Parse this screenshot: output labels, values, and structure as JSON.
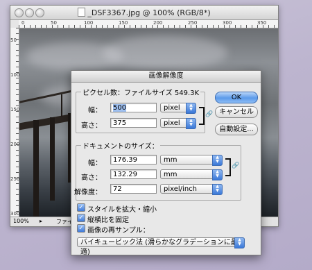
{
  "document": {
    "title": "_DSF3367.jpg @ 100% (RGB/8*)",
    "status": {
      "zoom": "100%",
      "info": "ファイル"
    },
    "ruler_top_labels": [
      "0",
      "50",
      "100",
      "150",
      "200",
      "250",
      "300",
      "350"
    ],
    "ruler_left_labels": [
      "50",
      "100",
      "150",
      "200",
      "250",
      "300"
    ]
  },
  "dialog": {
    "title": "画像解像度",
    "pixel_dimensions": {
      "header": "ピクセル数：ファイルサイズ 549.3K",
      "width_label": "幅：",
      "width_value": "500",
      "width_unit": "pixel",
      "height_label": "高さ：",
      "height_value": "375",
      "height_unit": "pixel"
    },
    "document_size": {
      "header": "ドキュメントのサイズ：",
      "width_label": "幅：",
      "width_value": "176.39",
      "width_unit": "mm",
      "height_label": "高さ：",
      "height_value": "132.29",
      "height_unit": "mm",
      "resolution_label": "解像度：",
      "resolution_value": "72",
      "resolution_unit": "pixel/inch"
    },
    "buttons": {
      "ok": "OK",
      "cancel": "キャンセル",
      "auto": "自動設定..."
    },
    "options": {
      "scale_styles": "スタイルを拡大・縮小",
      "constrain": "縦横比を固定",
      "resample": "画像の再サンプル：",
      "resample_method": "バイキュービック法 (滑らかなグラデーションに最適)"
    }
  }
}
